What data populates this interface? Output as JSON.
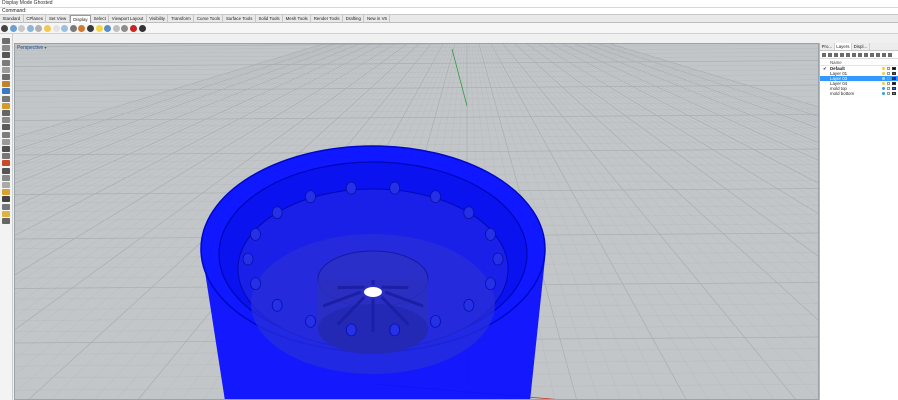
{
  "status_line": "Display Mode Ghosted",
  "command": {
    "label": "Command:"
  },
  "tabs": [
    "Standard",
    "CPlanes",
    "Set View",
    "Display",
    "Select",
    "Viewport Layout",
    "Visibility",
    "Transform",
    "Curve Tools",
    "Surface Tools",
    "Solid Tools",
    "Mesh Tools",
    "Render Tools",
    "Drafting",
    "New in V6"
  ],
  "active_tab": "Display",
  "toolbar_icon_colors": [
    "#444444",
    "#6a9fd4",
    "#c9c9c9",
    "#8fb3d9",
    "#b0b0b0",
    "#f2c94c",
    "#e3e3e3",
    "#9bbfe0",
    "#7a7a7a",
    "#d07a2d",
    "#3a3a3a",
    "#f5d742",
    "#5b8ec7",
    "#bfbfbf",
    "#8c8c8c",
    "#cc2222",
    "#333333"
  ],
  "viewport": {
    "title": "Perspective",
    "title_suffix": "▾",
    "accent": "#1e4b8f"
  },
  "right_panel": {
    "tabs": [
      {
        "label": "Pro..."
      },
      {
        "label": "Layers"
      },
      {
        "label": "Displ..."
      }
    ],
    "header": "Name",
    "layers": [
      {
        "name": "Default",
        "current": true,
        "selected": false,
        "bold": true,
        "color": "#000000",
        "bulb": "#f2d04a"
      },
      {
        "name": "Layer 01",
        "current": false,
        "selected": false,
        "bold": false,
        "color": "#d42020",
        "bulb": "#f2d04a"
      },
      {
        "name": "Layer 03",
        "current": false,
        "selected": true,
        "bold": false,
        "color": "#1e2ad6",
        "bulb": "#9ad0ff"
      },
      {
        "name": "Layer 04",
        "current": false,
        "selected": false,
        "bold": false,
        "color": "#111111",
        "bulb": "#f2d04a"
      },
      {
        "name": "mold top",
        "current": false,
        "selected": false,
        "bold": false,
        "color": "#2266ff",
        "bulb": "#3aa0e0"
      },
      {
        "name": "mold bottom",
        "current": false,
        "selected": false,
        "bold": false,
        "color": "#22c05a",
        "bulb": "#3aa0e0"
      }
    ],
    "check_glyph": "✔"
  },
  "colors": {
    "object_blue": "#0a10ff",
    "grid_bg": "#c3c6c8",
    "x_axis": "#c0392b",
    "y_axis": "#2e9e3a"
  }
}
